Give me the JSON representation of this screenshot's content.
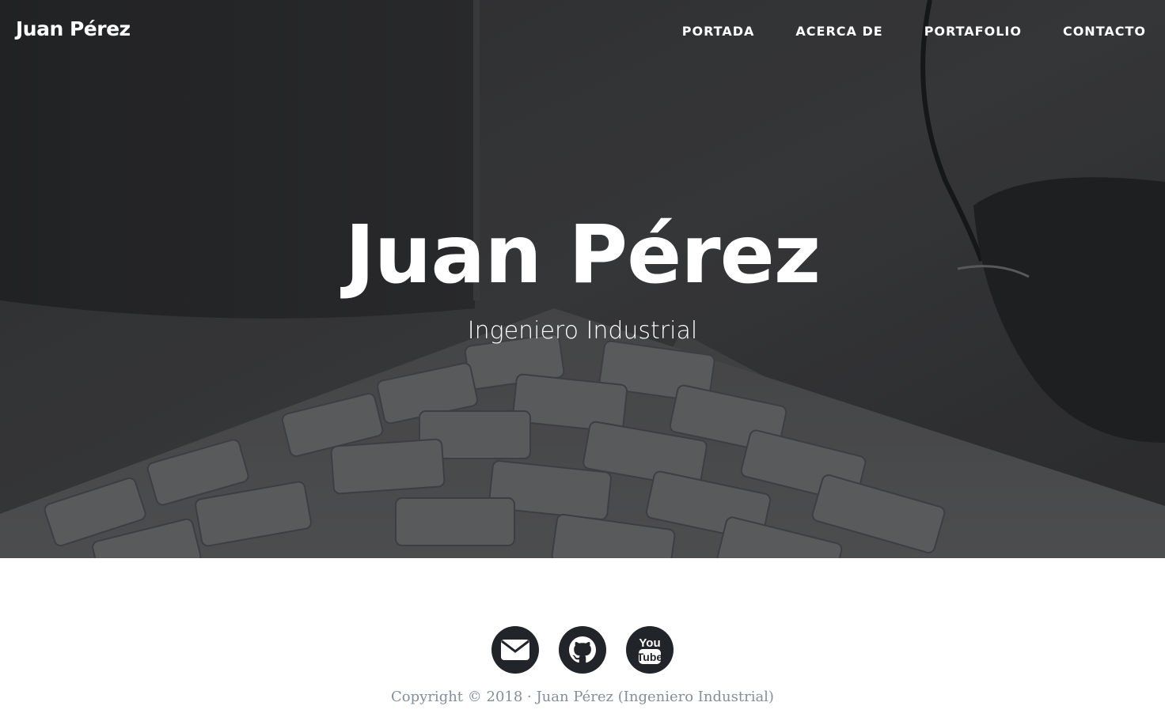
{
  "navbar": {
    "brand": "Juan Pérez",
    "links": [
      "PORTADA",
      "ACERCA DE",
      "PORTAFOLIO",
      "CONTACTO"
    ]
  },
  "hero": {
    "title": "Juan Pérez",
    "subtitle": "Ingeniero Industrial"
  },
  "footer": {
    "social": [
      {
        "icon": "envelope-icon"
      },
      {
        "icon": "github-icon"
      },
      {
        "icon": "youtube-icon",
        "text_line1": "You",
        "text_line2": "Tube"
      }
    ],
    "copyright": "Copyright © 2018 · Juan Pérez (Ingeniero Industrial)"
  },
  "colors": {
    "hero_overlay": "#3b3c3f",
    "social_bg": "#212529",
    "copyright_text": "#868e96"
  }
}
